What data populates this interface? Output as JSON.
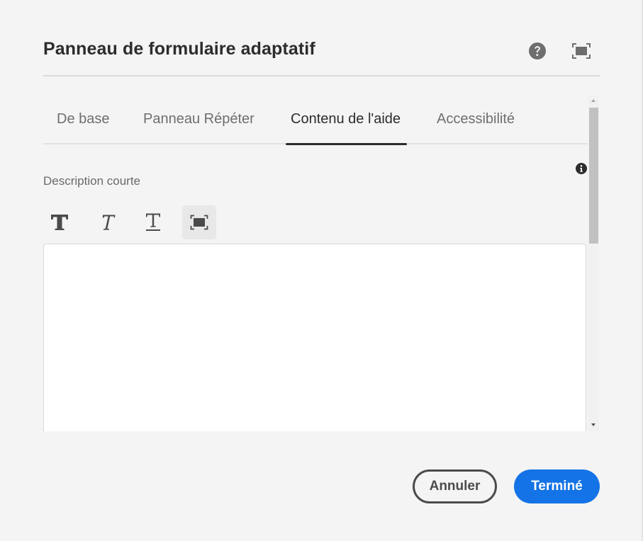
{
  "dialog": {
    "title": "Panneau de formulaire adaptatif"
  },
  "tabs": [
    {
      "label": "De base",
      "active": false
    },
    {
      "label": "Panneau Répéter",
      "active": false
    },
    {
      "label": "Contenu de l'aide",
      "active": true
    },
    {
      "label": "Accessibilité",
      "active": false
    }
  ],
  "field": {
    "label": "Description courte",
    "value": ""
  },
  "toolbar": {
    "icons": [
      "bold-icon",
      "italic-icon",
      "underline-icon",
      "fullscreen-icon"
    ]
  },
  "footer": {
    "cancel_label": "Annuler",
    "done_label": "Terminé"
  },
  "colors": {
    "accent": "#1473e6",
    "background": "#f4f4f4",
    "text": "#2c2c2c"
  }
}
